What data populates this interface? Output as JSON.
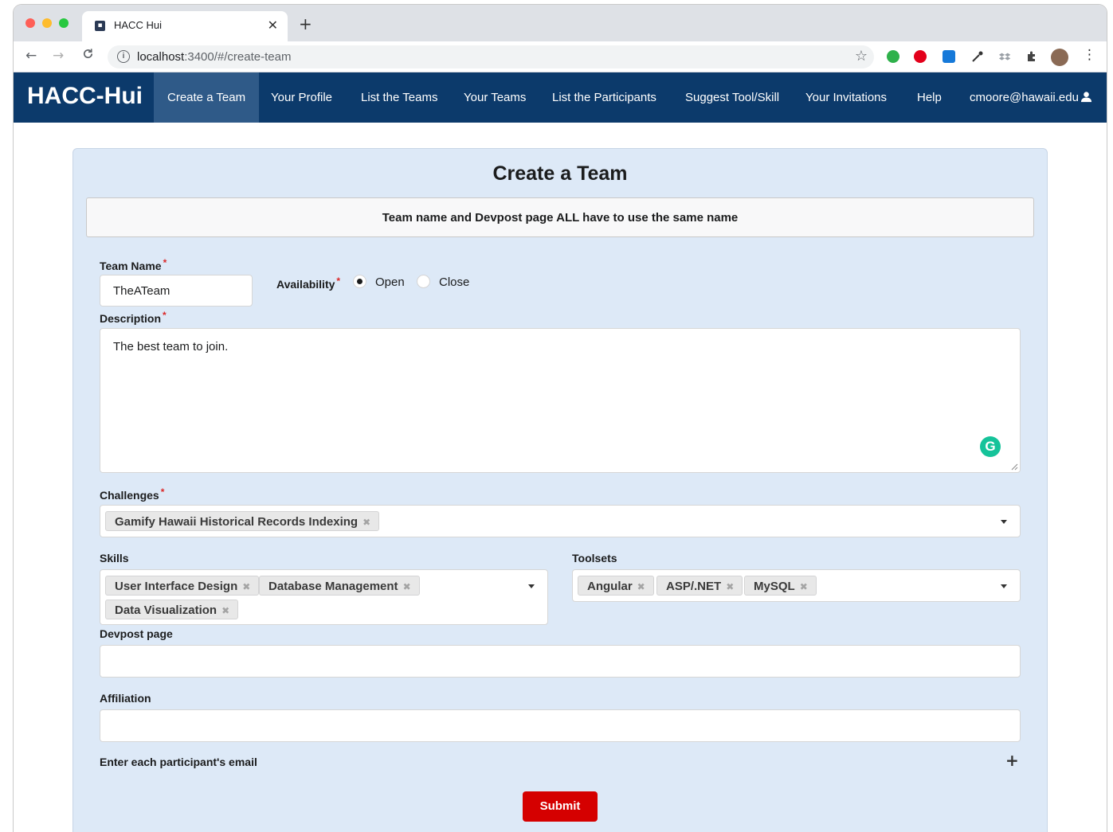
{
  "browser": {
    "tab_title": "HACC Hui",
    "tab_close": "✕",
    "new_tab": "+",
    "url_host": "localhost",
    "url_path": ":3400/#/create-team",
    "back": "←",
    "forward": "→",
    "reload": "C",
    "info": "i",
    "star": "☆",
    "menu": "⋮"
  },
  "navbar": {
    "brand": "HACC-Hui",
    "items": [
      {
        "label": "Create a Team",
        "active": true
      },
      {
        "label": "Your Profile"
      },
      {
        "label": "List the Teams"
      },
      {
        "label": "Your Teams"
      },
      {
        "label": "List the Participants"
      },
      {
        "label": "Suggest Tool/Skill"
      },
      {
        "label": "Your Invitations"
      },
      {
        "label": "Help"
      }
    ],
    "user": "cmoore@hawaii.edu"
  },
  "form": {
    "title": "Create a Team",
    "notice": "Team name and Devpost page ALL have to use the same name",
    "team_name_label": "Team Name",
    "team_name_value": "TheATeam",
    "availability_label": "Availability",
    "availability_options": [
      "Open",
      "Close"
    ],
    "availability_selected": "Open",
    "description_label": "Description",
    "description_value": "The best team to join.",
    "challenges_label": "Challenges",
    "challenges": [
      "Gamify Hawaii Historical Records Indexing"
    ],
    "skills_label": "Skills",
    "skills": [
      "User Interface Design",
      "Database Management",
      "Data Visualization"
    ],
    "toolsets_label": "Toolsets",
    "toolsets": [
      "Angular",
      "ASP/.NET",
      "MySQL"
    ],
    "devpost_label": "Devpost page",
    "devpost_value": "",
    "affiliation_label": "Affiliation",
    "affiliation_value": "",
    "participants_label": "Enter each participant's email",
    "submit_label": "Submit",
    "required_mark": "*",
    "remove_mark": "✖",
    "add_mark": "+"
  },
  "colors": {
    "navbar": "#0c3a6b",
    "nav_active": "#2f5a88",
    "card_bg": "#dde9f7",
    "submit": "#d50000",
    "required": "#db2828"
  }
}
